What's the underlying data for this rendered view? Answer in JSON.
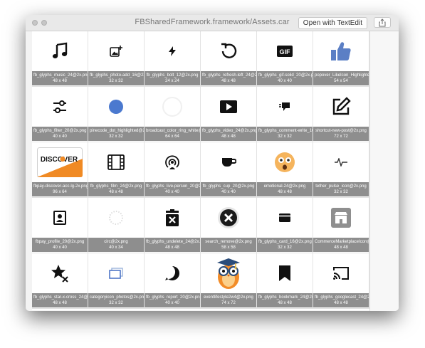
{
  "window": {
    "title": "FBSharedFramework.framework/Assets.car",
    "open_button_label": "Open with TextEdit",
    "share_icon": "share-icon"
  },
  "assets": [
    {
      "name": "fb_glyphs_music_24@2x.png",
      "size": "48 x 48",
      "icon": "music-note-icon"
    },
    {
      "name": "fb_glyphs_photo-add_16@2x.png",
      "size": "32 x 32",
      "icon": "photo-add-icon"
    },
    {
      "name": "fb_glyphs_bolt_12@2x.png",
      "size": "24 x 24",
      "icon": "bolt-icon"
    },
    {
      "name": "fb_glyphs_refresh-left_24@2x.png",
      "size": "48 x 48",
      "icon": "refresh-icon"
    },
    {
      "name": "fb_glyphs_gif-solid_20@2x.png",
      "size": "40 x 40",
      "icon": "gif-icon"
    },
    {
      "name": "popover_LikeIcon_Highlighted@2x.png",
      "size": "54 x 54",
      "icon": "thumbs-up-icon"
    },
    {
      "name": "fb_glyphs_filter_20@2x.png",
      "size": "40 x 40",
      "icon": "filter-sliders-icon"
    },
    {
      "name": "pinecode_dot_highlighted@2x.png",
      "size": "32 x 32",
      "icon": "dot-icon"
    },
    {
      "name": "broadcast_color_ring_white@2x.png",
      "size": "64 x 64",
      "icon": "ring-icon"
    },
    {
      "name": "fb_glyphs_video_24@2x.png",
      "size": "48 x 48",
      "icon": "video-play-icon"
    },
    {
      "name": "fb_glyphs_comment-write_16@2x.png",
      "size": "32 x 32",
      "icon": "comment-icon"
    },
    {
      "name": "shortcut-new-post@2x.png",
      "size": "72 x 72",
      "icon": "compose-icon"
    },
    {
      "name": "fbpay-discover-acc-lg-2x.png",
      "size": "96 x 64",
      "icon": "discover-card-icon"
    },
    {
      "name": "fb_glyphs_film_24@2x.png",
      "size": "48 x 48",
      "icon": "film-icon"
    },
    {
      "name": "fb_glyphs_live-person_20@2x.png",
      "size": "40 x 40",
      "icon": "live-person-icon"
    },
    {
      "name": "fb_glyphs_cup_20@2x.png",
      "size": "40 x 40",
      "icon": "cup-icon"
    },
    {
      "name": "emotional-24@2x.png",
      "size": "48 x 48",
      "icon": "shocked-face-icon"
    },
    {
      "name": "tether_pulse_icon@2x.png",
      "size": "32 x 32",
      "icon": "pulse-icon"
    },
    {
      "name": "fbpay_profile_20@2x.png",
      "size": "40 x 40",
      "icon": "profile-icon"
    },
    {
      "name": "circ@2x.png",
      "size": "40 x 34",
      "icon": "dotted-placeholder-icon"
    },
    {
      "name": "fb_glyphs_undelete_24@2x.png",
      "size": "48 x 48",
      "icon": "trash-x-icon"
    },
    {
      "name": "search_remove@2x.png",
      "size": "58 x 58",
      "icon": "remove-circle-icon"
    },
    {
      "name": "fb_glyphs_card_16@2x.png",
      "size": "32 x 32",
      "icon": "card-icon"
    },
    {
      "name": "CommerceMarketplaceIcon@2x.png",
      "size": "48 x 48",
      "icon": "storefront-icon"
    },
    {
      "name": "fb_glyphs_star-x-cross_24@2x.png",
      "size": "48 x 48",
      "icon": "star-x-icon"
    },
    {
      "name": "categoryicon_photos@2x.png",
      "size": "32 x 32",
      "icon": "photos-icon"
    },
    {
      "name": "fb_glyphs_report_20@2x.png",
      "size": "40 x 40",
      "icon": "report-icon"
    },
    {
      "name": "eventlifestyle2w4@2x.png",
      "size": "74 x 72",
      "icon": "owl-icon"
    },
    {
      "name": "fb_glyphs_bookmark_24@2x.png",
      "size": "48 x 48",
      "icon": "bookmark-icon"
    },
    {
      "name": "fb_glyphs_googlecast_24@2x.png",
      "size": "48 x 48",
      "icon": "cast-icon"
    }
  ]
}
